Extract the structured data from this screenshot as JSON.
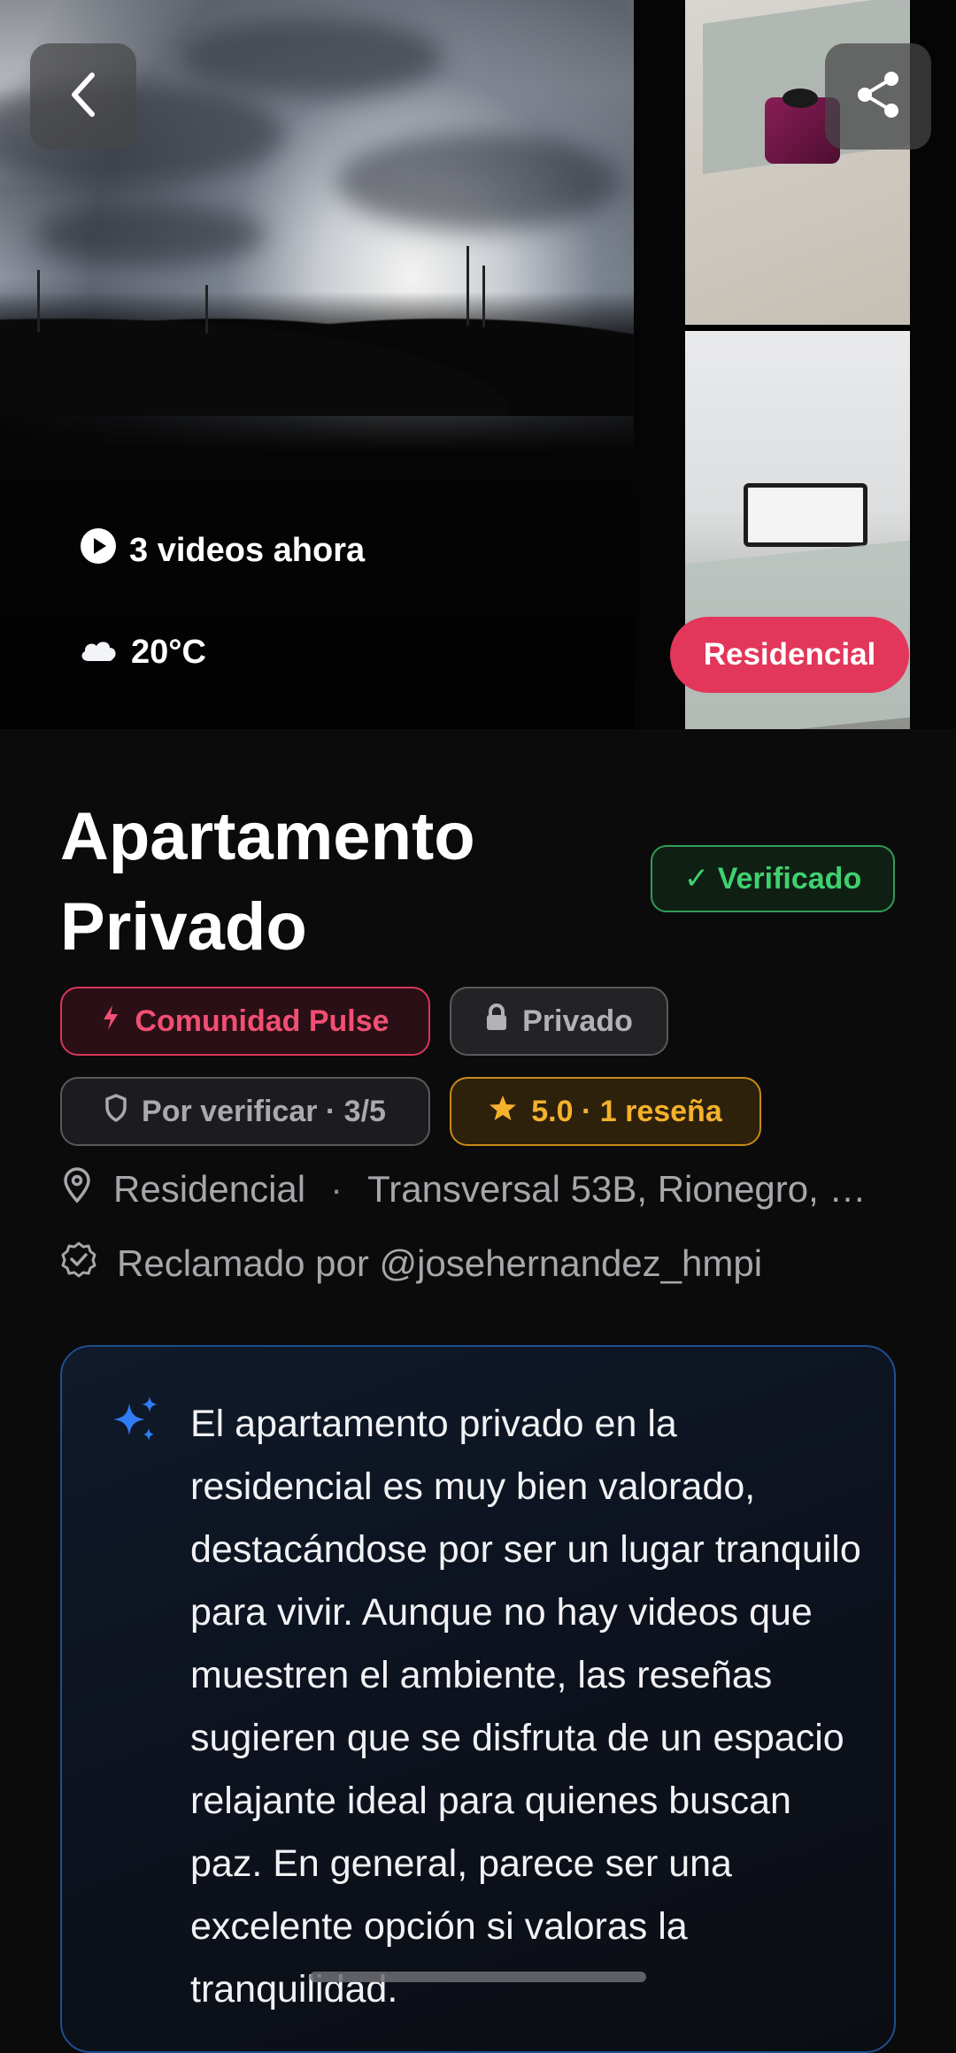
{
  "hero": {
    "videos_label": "3 videos ahora",
    "weather_temp": "20°C",
    "category_pill": "Residencial",
    "icons": {
      "back": "chevron-left-icon",
      "share": "share-icon",
      "play": "play-circle-icon",
      "weather": "cloud-icon"
    }
  },
  "place": {
    "title": "Apartamento Privado",
    "verified_label": "✓ Verificado"
  },
  "chips": {
    "pulse": "Comunidad Pulse",
    "privacy": "Privado",
    "verify_status": "Por verificar · 3/5",
    "rating": "5.0 · 1 reseña"
  },
  "meta": {
    "category": "Residencial",
    "separator": "·",
    "address": "Transversal 53B, Rionegro, …",
    "claimed_by": "Reclamado por @josehernandez_hmpi"
  },
  "ai_summary": {
    "text": "El apartamento privado en la residencial es muy bien valorado, destacándose por ser un lugar tranquilo para vivir. Aunque no hay videos que muestren el ambiente, las reseñas sugieren que se disfruta de un espacio relajante ideal para quienes buscan paz. En general, parece ser una excelente opción si valoras la tranquilidad."
  },
  "colors": {
    "accent_pink": "#e2365a",
    "verified_green": "#3fd06f",
    "rating_gold": "#f4b12c",
    "ai_border_blue": "#1e4f8f"
  }
}
